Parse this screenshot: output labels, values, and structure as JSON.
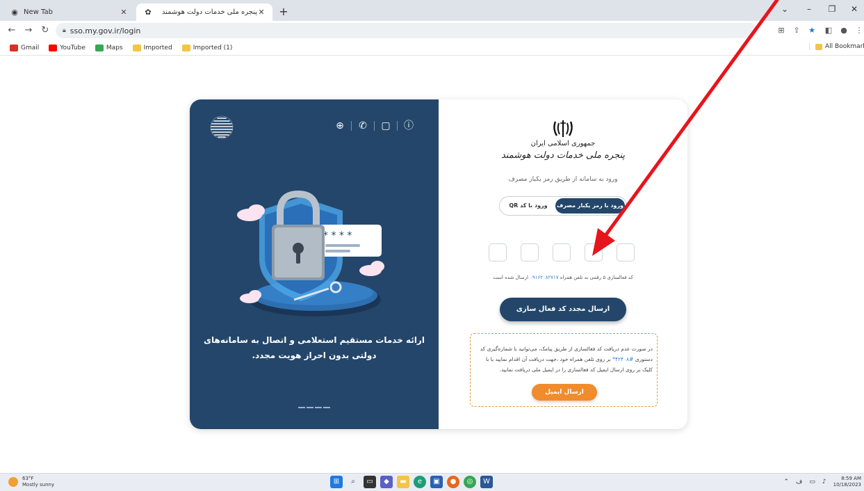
{
  "browser": {
    "tabs": [
      {
        "title": "New Tab",
        "icon": "chrome-icon"
      },
      {
        "title": "پنجره ملی خدمات دولت هوشمند",
        "icon": "gov-emblem-icon"
      }
    ],
    "url": "sso.my.gov.ir/login",
    "bookmarks": [
      {
        "label": "Gmail",
        "color": "#d93025"
      },
      {
        "label": "YouTube",
        "color": "#ff0000"
      },
      {
        "label": "Maps",
        "color": "#34a853"
      },
      {
        "label": "Imported",
        "color": "#f4c542"
      },
      {
        "label": "Imported (1)",
        "color": "#f4c542"
      }
    ],
    "all_bookmarks": "All Bookmarks"
  },
  "left_panel": {
    "icons": [
      "info-icon",
      "chat-icon",
      "phone-icon",
      "globe-icon"
    ],
    "promo_line1": "ارائه خدمات مستقیم استعلامی و اتصال به سامانه‌های",
    "promo_line2": "دولتی بدون احراز هویت مجدد.",
    "colors": {
      "panel_bg": "#24466a"
    }
  },
  "right_panel": {
    "gov_line1": "جمهوری اسلامی ایران",
    "gov_line2": "پنجره ملی خدمات دولت هوشمند",
    "subtitle": "ورود به سامانه از طریق رمز یکبار مصرف",
    "toggle_active": "ورود با رمز یکبار مصرف",
    "toggle_other": "ورود با کد QR",
    "otp_count": 5,
    "sent_prefix": "کد فعالسازی ۵ رقمی به تلفن همراه ",
    "sent_phone": "۰۹۱۶۲۰۸۲۷۱۷",
    "sent_suffix": " ارسال شده است",
    "resend_button": "ارسال مجدد کد فعال سازی",
    "info_part1": "در صورت عدم دریافت کد فعالسازی از طریق پیامک، می‌توانید با شماره‌گیری کد دستوری ",
    "info_code": "#۴۲۴۰۸*",
    "info_part2": " بر روی تلفن همراه خود ،جهت دریافت آن اقدام نمایید یا با کلیک بر روی ارسال ایمیل کد فعالسازی را در ایمیل ملی دریافت نمایید.",
    "email_button": "ارسال ایمیل",
    "colors": {
      "primary": "#24466a",
      "orange": "#f08c2b",
      "link": "#2f7fd0"
    }
  },
  "annotation": {
    "arrow_color": "#e8141c"
  },
  "taskbar": {
    "temp": "63°F",
    "weather": "Mostly sunny",
    "time": "8:59 AM",
    "date": "10/18/2023"
  }
}
